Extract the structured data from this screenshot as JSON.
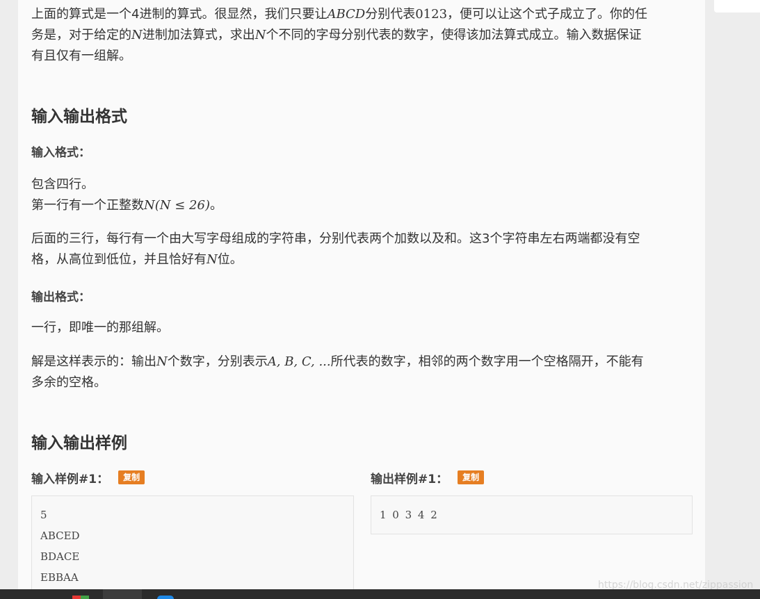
{
  "intro": {
    "line1_a": "上面的算式是一个4进制的算式。很显然，我们只要让",
    "line1_math": "ABCD",
    "line1_b": "分别代表",
    "line1_num": "0123",
    "line1_c": "，便可以让这个式子成立了。你的任",
    "line2_a": "务是，对于给定的",
    "line2_math1": "N",
    "line2_b": "进制加法算式，求出",
    "line2_math2": "N",
    "line2_c": "个不同的字母分别代表的数字，使得该加法算式成立。输入数据保证",
    "line3": "有且仅有一组解。"
  },
  "section_io": {
    "title": "输入输出格式",
    "input_title": "输入格式：",
    "input_p1_line1": "包含四行。",
    "input_p1_line2_a": "第一行有一个正整数",
    "input_p1_line2_math": "N(N ≤ 26)",
    "input_p1_line2_b": "。",
    "input_p2_line1": "后面的三行，每行有一个由大写字母组成的字符串，分别代表两个加数以及和。这3个字符串左右两端都没有空",
    "input_p2_line2_a": "格，从高位到低位，并且恰好有",
    "input_p2_line2_math": "N",
    "input_p2_line2_b": "位。",
    "output_title": "输出格式：",
    "output_p1": "一行，即唯一的那组解。",
    "output_p2_line1_a": "解是这样表示的：输出",
    "output_p2_line1_math1": "N",
    "output_p2_line1_b": "个数字，分别表示",
    "output_p2_line1_math2": "A, B, C, ...",
    "output_p2_line1_c": "所代表的数字，相邻的两个数字用一个空格隔开，不能有",
    "output_p2_line2": "多余的空格。"
  },
  "section_samples": {
    "title": "输入输出样例",
    "input_label": "输入样例#1：",
    "output_label": "输出样例#1：",
    "copy_label": "复制",
    "input_lines": [
      "5",
      "ABCED",
      "BDACE",
      "EBBAA"
    ],
    "output_lines": [
      "1 0 3 4 2"
    ]
  },
  "watermark": "https://blog.csdn.net/zippassion",
  "colors": {
    "copy_button": "#e67e22",
    "panel": "#fafafa",
    "background": "#ededed"
  }
}
